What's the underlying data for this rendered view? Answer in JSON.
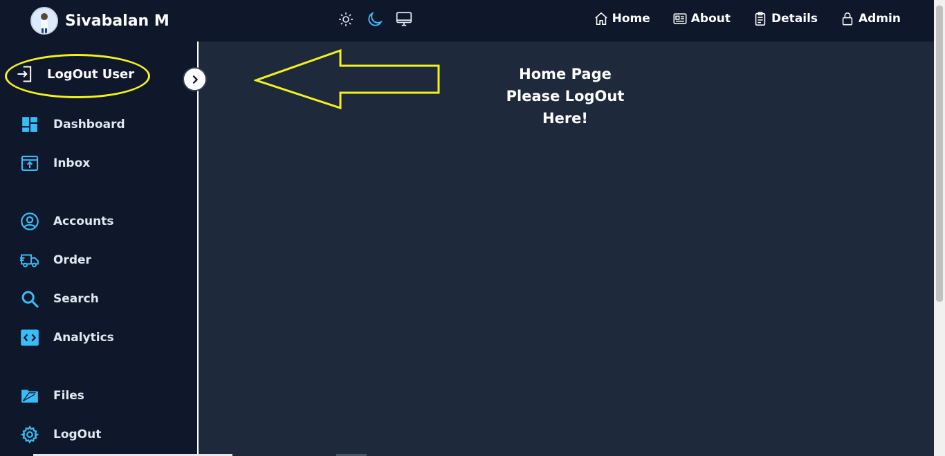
{
  "header": {
    "brand_name": "Sivabalan M",
    "theme_icons": [
      "sun-icon",
      "moon-icon",
      "monitor-icon"
    ],
    "nav": [
      {
        "label": "Home",
        "icon": "home-icon"
      },
      {
        "label": "About",
        "icon": "id-card-icon"
      },
      {
        "label": "Details",
        "icon": "clipboard-icon"
      },
      {
        "label": "Admin",
        "icon": "lock-icon"
      }
    ]
  },
  "sidebar": {
    "logout_user_label": "LogOut User",
    "items": [
      {
        "label": "Dashboard",
        "icon": "dashboard-icon"
      },
      {
        "label": "Inbox",
        "icon": "inbox-icon"
      },
      {
        "label": "Accounts",
        "icon": "user-circle-icon"
      },
      {
        "label": "Order",
        "icon": "truck-icon"
      },
      {
        "label": "Search",
        "icon": "search-icon"
      },
      {
        "label": "Analytics",
        "icon": "code-icon"
      },
      {
        "label": "Files",
        "icon": "folder-icon"
      },
      {
        "label": "LogOut",
        "icon": "gear-icon"
      }
    ]
  },
  "main": {
    "title": "Home Page",
    "subtitle": "Please LogOut Here!"
  },
  "colors": {
    "header_bg": "#0f172a",
    "main_bg": "#1e293b",
    "accent": "#38bdf8",
    "annotation": "#f2f21d"
  }
}
